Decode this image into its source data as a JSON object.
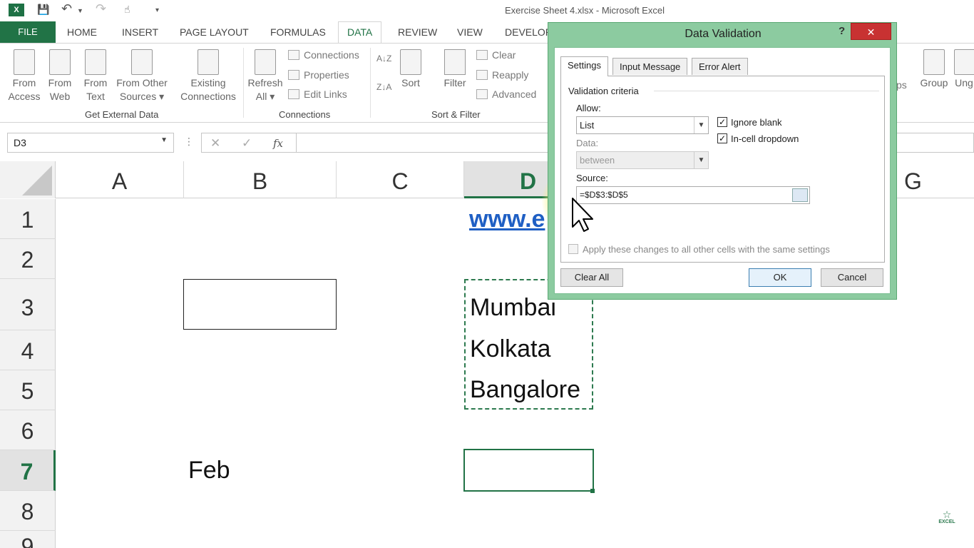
{
  "window": {
    "title": "Exercise Sheet 4.xlsx - Microsoft Excel",
    "logo": "X"
  },
  "tabs": {
    "file": "FILE",
    "home": "HOME",
    "insert": "INSERT",
    "page_layout": "PAGE LAYOUT",
    "formulas": "FORMULAS",
    "data": "DATA",
    "review": "REVIEW",
    "view": "VIEW",
    "developer": "DEVELOP"
  },
  "ribbon": {
    "get_external": {
      "label": "Get External Data",
      "from_access": [
        "From",
        "Access"
      ],
      "from_web": [
        "From",
        "Web"
      ],
      "from_text": [
        "From",
        "Text"
      ],
      "from_other": [
        "From Other",
        "Sources ▾"
      ],
      "existing": [
        "Existing",
        "Connections"
      ]
    },
    "connections": {
      "label": "Connections",
      "refresh": [
        "Refresh",
        "All ▾"
      ],
      "connections": "Connections",
      "properties": "Properties",
      "edit_links": "Edit Links"
    },
    "sort_filter": {
      "label": "Sort & Filter",
      "sort": "Sort",
      "filter": "Filter",
      "clear": "Clear",
      "reapply": "Reapply",
      "advanced": "Advanced"
    },
    "right": {
      "ps": "ps",
      "group": "Group",
      "ungroup": "Ung"
    }
  },
  "formula_bar": {
    "name_box": "D3",
    "cancel": "✕",
    "enter": "✓",
    "fx": "fx",
    "value": ""
  },
  "columns": [
    "A",
    "B",
    "C",
    "D",
    "G"
  ],
  "rows": [
    "1",
    "2",
    "3",
    "4",
    "5",
    "6",
    "7",
    "8",
    "9"
  ],
  "cells": {
    "d1": "www.e",
    "d3": "Mumbai",
    "d4": "Kolkata",
    "d5": "Bangalore",
    "b7": "Feb"
  },
  "dialog": {
    "title": "Data Validation",
    "help": "?",
    "close": "✕",
    "tabs": [
      "Settings",
      "Input Message",
      "Error Alert"
    ],
    "section": "Validation criteria",
    "allow_label": "Allow:",
    "allow_value": "List",
    "data_label": "Data:",
    "data_value": "between",
    "source_label": "Source:",
    "source_value": "=$D$3:$D$5",
    "ignore_blank": {
      "label": "Ignore blank",
      "checked": true
    },
    "in_cell_dropdown": {
      "label": "In-cell dropdown",
      "checked": true
    },
    "apply_all": {
      "label": "Apply these changes to all other cells with the same settings",
      "checked": false
    },
    "clear_all": "Clear All",
    "ok": "OK",
    "cancel": "Cancel"
  },
  "watermark": {
    "line1": "EXCEL"
  },
  "colors": {
    "excel_green": "#217346",
    "dialog_border": "#8ccba0",
    "close_red": "#c83232",
    "link_blue": "#1f5fc4"
  }
}
